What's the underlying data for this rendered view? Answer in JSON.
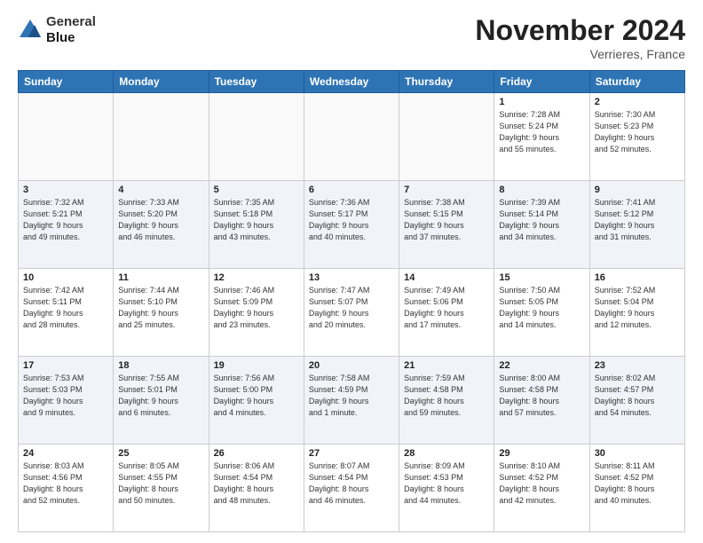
{
  "header": {
    "logo_line1": "General",
    "logo_line2": "Blue",
    "month": "November 2024",
    "location": "Verrieres, France"
  },
  "weekdays": [
    "Sunday",
    "Monday",
    "Tuesday",
    "Wednesday",
    "Thursday",
    "Friday",
    "Saturday"
  ],
  "weeks": [
    [
      {
        "day": "",
        "info": ""
      },
      {
        "day": "",
        "info": ""
      },
      {
        "day": "",
        "info": ""
      },
      {
        "day": "",
        "info": ""
      },
      {
        "day": "",
        "info": ""
      },
      {
        "day": "1",
        "info": "Sunrise: 7:28 AM\nSunset: 5:24 PM\nDaylight: 9 hours\nand 55 minutes."
      },
      {
        "day": "2",
        "info": "Sunrise: 7:30 AM\nSunset: 5:23 PM\nDaylight: 9 hours\nand 52 minutes."
      }
    ],
    [
      {
        "day": "3",
        "info": "Sunrise: 7:32 AM\nSunset: 5:21 PM\nDaylight: 9 hours\nand 49 minutes."
      },
      {
        "day": "4",
        "info": "Sunrise: 7:33 AM\nSunset: 5:20 PM\nDaylight: 9 hours\nand 46 minutes."
      },
      {
        "day": "5",
        "info": "Sunrise: 7:35 AM\nSunset: 5:18 PM\nDaylight: 9 hours\nand 43 minutes."
      },
      {
        "day": "6",
        "info": "Sunrise: 7:36 AM\nSunset: 5:17 PM\nDaylight: 9 hours\nand 40 minutes."
      },
      {
        "day": "7",
        "info": "Sunrise: 7:38 AM\nSunset: 5:15 PM\nDaylight: 9 hours\nand 37 minutes."
      },
      {
        "day": "8",
        "info": "Sunrise: 7:39 AM\nSunset: 5:14 PM\nDaylight: 9 hours\nand 34 minutes."
      },
      {
        "day": "9",
        "info": "Sunrise: 7:41 AM\nSunset: 5:12 PM\nDaylight: 9 hours\nand 31 minutes."
      }
    ],
    [
      {
        "day": "10",
        "info": "Sunrise: 7:42 AM\nSunset: 5:11 PM\nDaylight: 9 hours\nand 28 minutes."
      },
      {
        "day": "11",
        "info": "Sunrise: 7:44 AM\nSunset: 5:10 PM\nDaylight: 9 hours\nand 25 minutes."
      },
      {
        "day": "12",
        "info": "Sunrise: 7:46 AM\nSunset: 5:09 PM\nDaylight: 9 hours\nand 23 minutes."
      },
      {
        "day": "13",
        "info": "Sunrise: 7:47 AM\nSunset: 5:07 PM\nDaylight: 9 hours\nand 20 minutes."
      },
      {
        "day": "14",
        "info": "Sunrise: 7:49 AM\nSunset: 5:06 PM\nDaylight: 9 hours\nand 17 minutes."
      },
      {
        "day": "15",
        "info": "Sunrise: 7:50 AM\nSunset: 5:05 PM\nDaylight: 9 hours\nand 14 minutes."
      },
      {
        "day": "16",
        "info": "Sunrise: 7:52 AM\nSunset: 5:04 PM\nDaylight: 9 hours\nand 12 minutes."
      }
    ],
    [
      {
        "day": "17",
        "info": "Sunrise: 7:53 AM\nSunset: 5:03 PM\nDaylight: 9 hours\nand 9 minutes."
      },
      {
        "day": "18",
        "info": "Sunrise: 7:55 AM\nSunset: 5:01 PM\nDaylight: 9 hours\nand 6 minutes."
      },
      {
        "day": "19",
        "info": "Sunrise: 7:56 AM\nSunset: 5:00 PM\nDaylight: 9 hours\nand 4 minutes."
      },
      {
        "day": "20",
        "info": "Sunrise: 7:58 AM\nSunset: 4:59 PM\nDaylight: 9 hours\nand 1 minute."
      },
      {
        "day": "21",
        "info": "Sunrise: 7:59 AM\nSunset: 4:58 PM\nDaylight: 8 hours\nand 59 minutes."
      },
      {
        "day": "22",
        "info": "Sunrise: 8:00 AM\nSunset: 4:58 PM\nDaylight: 8 hours\nand 57 minutes."
      },
      {
        "day": "23",
        "info": "Sunrise: 8:02 AM\nSunset: 4:57 PM\nDaylight: 8 hours\nand 54 minutes."
      }
    ],
    [
      {
        "day": "24",
        "info": "Sunrise: 8:03 AM\nSunset: 4:56 PM\nDaylight: 8 hours\nand 52 minutes."
      },
      {
        "day": "25",
        "info": "Sunrise: 8:05 AM\nSunset: 4:55 PM\nDaylight: 8 hours\nand 50 minutes."
      },
      {
        "day": "26",
        "info": "Sunrise: 8:06 AM\nSunset: 4:54 PM\nDaylight: 8 hours\nand 48 minutes."
      },
      {
        "day": "27",
        "info": "Sunrise: 8:07 AM\nSunset: 4:54 PM\nDaylight: 8 hours\nand 46 minutes."
      },
      {
        "day": "28",
        "info": "Sunrise: 8:09 AM\nSunset: 4:53 PM\nDaylight: 8 hours\nand 44 minutes."
      },
      {
        "day": "29",
        "info": "Sunrise: 8:10 AM\nSunset: 4:52 PM\nDaylight: 8 hours\nand 42 minutes."
      },
      {
        "day": "30",
        "info": "Sunrise: 8:11 AM\nSunset: 4:52 PM\nDaylight: 8 hours\nand 40 minutes."
      }
    ]
  ]
}
